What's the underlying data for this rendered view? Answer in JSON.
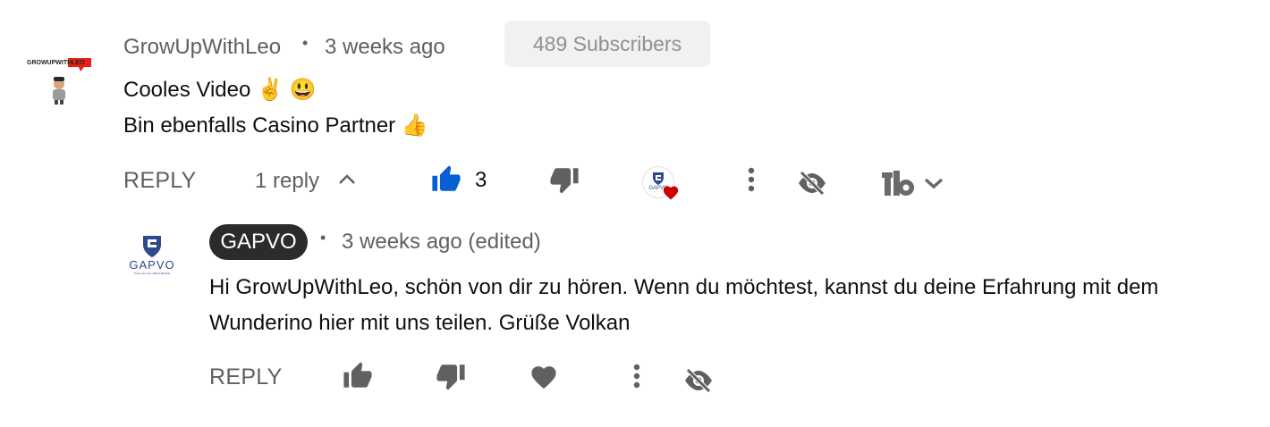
{
  "comment": {
    "author": "GrowUpWithLeo",
    "separator": "•",
    "time": "3 weeks ago",
    "subscribers": "489 Subscribers",
    "avatar_text": "GROWUPWITHLEO",
    "lines": [
      "Cooles Video ✌️ 😃",
      "Bin ebenfalls Casino Partner 👍"
    ],
    "actions": {
      "reply_label": "REPLY",
      "replies_toggle": "1 reply",
      "like_count": "3",
      "creator_heart_text": "GAPVO"
    }
  },
  "reply": {
    "author": "GAPVO",
    "separator": "•",
    "time": "3 weeks ago (edited)",
    "avatar_text": "GAPVO",
    "avatar_tagline": "Trust your own official Website",
    "lines": [
      "Hi GrowUpWithLeo, schön von dir zu hören. Wenn du möchtest, kannst du deine Erfahrung mit dem",
      "Wunderino hier mit uns teilen. Grüße Volkan"
    ],
    "actions": {
      "reply_label": "REPLY"
    }
  },
  "colors": {
    "like_active": "#065fd4",
    "icon_gray": "#606060",
    "heart_red": "#cc0000",
    "chip_bg": "#2b2b2b"
  },
  "icons": [
    "thumbs-up-icon",
    "thumbs-down-icon",
    "heart-icon",
    "more-icon",
    "hide-icon",
    "tubebuddy-icon",
    "chevron-up-icon",
    "chevron-down-icon"
  ]
}
